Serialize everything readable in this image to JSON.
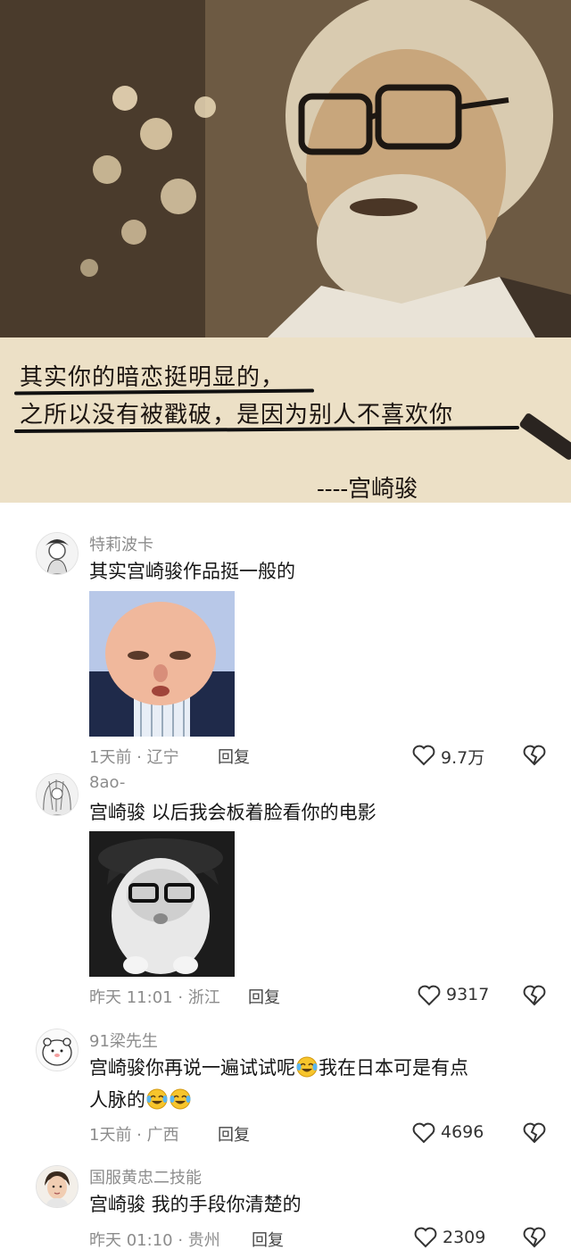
{
  "quote_image": {
    "line1": "其实你的暗恋挺明显的，",
    "line2": "之所以没有被戳破，是因为别人不喜欢你",
    "signature": "----宫崎骏"
  },
  "comments": [
    {
      "username": "特莉波卡",
      "text": "其实宫崎骏作品挺一般的",
      "time_location": "1天前 · 辽宁",
      "reply_label": "回复",
      "likes": "9.7万",
      "sticker": "meme-face-sticker-1"
    },
    {
      "username": "8ao-",
      "text": "宫崎骏 以后我会板着脸看你的电影",
      "time_location": "昨天 11:01 · 浙江",
      "reply_label": "回复",
      "likes": "9317",
      "sticker": "meme-face-sticker-2"
    },
    {
      "username": "91梁先生",
      "text_part1": "宫崎骏你再说一遍试试呢",
      "text_part2": "我在日本可是有点",
      "text_part3": "人脉的",
      "time_location": "1天前 · 广西",
      "reply_label": "回复",
      "likes": "4696",
      "emoji": "laughing-crying-emoji"
    },
    {
      "username": "国服黄忠二技能",
      "text": "宫崎骏 我的手段你清楚的",
      "time_location": "昨天 01:10 · 贵州",
      "reply_label": "回复",
      "likes": "2309"
    }
  ],
  "colors": {
    "meta_gray": "#8c8c8c",
    "text_dark": "#161616",
    "paper": "#ece0c6"
  }
}
